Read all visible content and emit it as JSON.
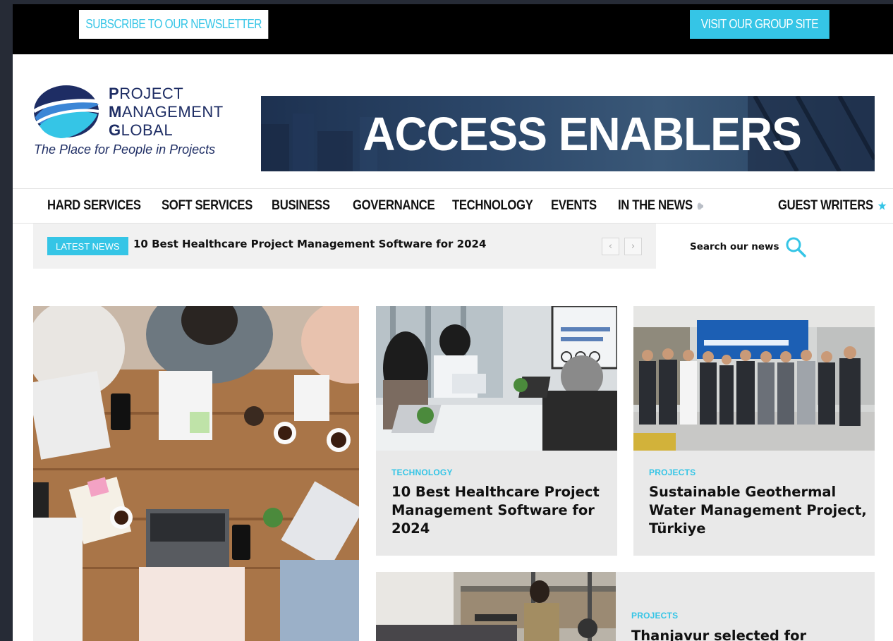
{
  "topbar": {
    "subscribe_label": "SUBSCRIBE TO OUR NEWSLETTER",
    "group_site_label": "VISIT OUR GROUP SITE"
  },
  "logo": {
    "line1_initial": "P",
    "line1_rest": "ROJECT",
    "line2_initial": "M",
    "line2_rest": "ANAGEMENT",
    "line3_initial": "G",
    "line3_rest": "LOBAL",
    "tagline": "The Place for People in Projects"
  },
  "banner": {
    "text": "ACCESS ENABLERS"
  },
  "nav": {
    "items": [
      {
        "label": "HARD SERVICES"
      },
      {
        "label": "SOFT SERVICES"
      },
      {
        "label": "BUSINESS"
      },
      {
        "label": "GOVERNANCE"
      },
      {
        "label": "TECHNOLOGY"
      },
      {
        "label": "EVENTS"
      },
      {
        "label": "IN THE NEWS",
        "icon": "speaker-icon"
      },
      {
        "label": "GUEST WRITERS",
        "icon": "star-icon"
      }
    ]
  },
  "latest_news": {
    "badge": "LATEST NEWS",
    "title": "10 Best Healthcare Project Management Software for 2024",
    "prev_icon": "chevron-left-icon",
    "next_icon": "chevron-right-icon"
  },
  "search": {
    "label": "Search our news",
    "icon": "search-icon"
  },
  "articles": [
    {
      "category": "",
      "title": ""
    },
    {
      "category": "TECHNOLOGY",
      "title": "10 Best Healthcare Project Management Software for 2024"
    },
    {
      "category": "PROJECTS",
      "title": "Sustainable Geothermal Water Management Project, Türkiye"
    },
    {
      "category": "PROJECTS",
      "title": "Thanjavur selected for"
    }
  ],
  "colors": {
    "accent": "#35c5e6",
    "brand_navy": "#1e2d64",
    "topbar_bg": "#000000",
    "card_bg": "#e9e9e9"
  }
}
